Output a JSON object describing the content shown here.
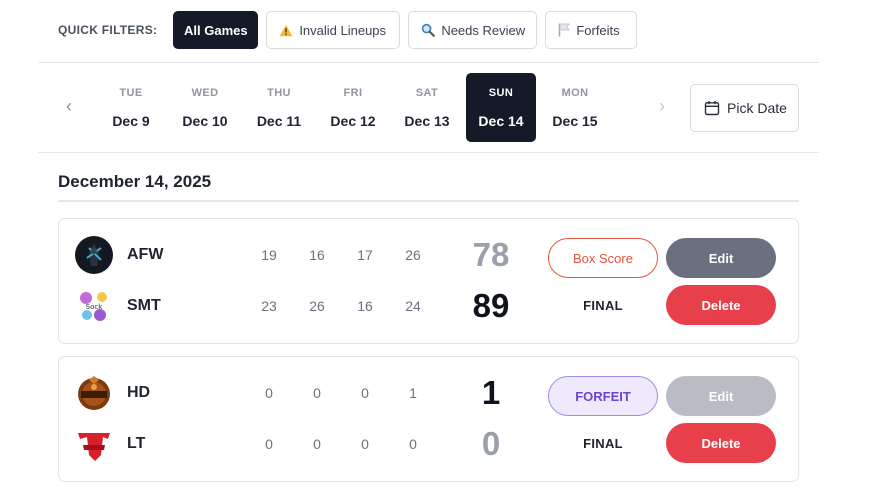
{
  "filters": {
    "label": "QUICK FILTERS:",
    "items": [
      {
        "label": "All Games",
        "icon": "none",
        "active": true
      },
      {
        "label": "Invalid Lineups",
        "icon": "warning-icon"
      },
      {
        "label": "Needs Review",
        "icon": "magnifier-icon"
      },
      {
        "label": "Forfeits",
        "icon": "flag-icon"
      }
    ]
  },
  "dates": {
    "prev_label": "‹",
    "next_label": "›",
    "days": [
      {
        "dow": "TUE",
        "date": "Dec 9"
      },
      {
        "dow": "WED",
        "date": "Dec 10"
      },
      {
        "dow": "THU",
        "date": "Dec 11"
      },
      {
        "dow": "FRI",
        "date": "Dec 12"
      },
      {
        "dow": "SAT",
        "date": "Dec 13"
      },
      {
        "dow": "SUN",
        "date": "Dec 14",
        "active": true
      },
      {
        "dow": "MON",
        "date": "Dec 15"
      }
    ],
    "pick_label": "Pick Date"
  },
  "heading": "December 14, 2025",
  "games": [
    {
      "home": {
        "name": "AFW",
        "quarters": [
          "19",
          "16",
          "17",
          "26"
        ],
        "total": "78",
        "result": "lose",
        "logo": "afw-logo"
      },
      "away": {
        "name": "SMT",
        "quarters": [
          "23",
          "26",
          "16",
          "24"
        ],
        "total": "89",
        "result": "win",
        "logo": "smt-logo"
      },
      "tag_label": "Box Score",
      "status": "FINAL",
      "edit_label": "Edit",
      "delete_label": "Delete"
    },
    {
      "home": {
        "name": "HD",
        "quarters": [
          "0",
          "0",
          "0",
          "1"
        ],
        "total": "1",
        "result": "win",
        "logo": "hd-logo"
      },
      "away": {
        "name": "LT",
        "quarters": [
          "0",
          "0",
          "0",
          "0"
        ],
        "total": "0",
        "result": "lose",
        "logo": "lt-logo"
      },
      "tag_label": "FORFEIT",
      "status": "FINAL",
      "edit_label": "Edit",
      "delete_label": "Delete"
    }
  ],
  "colors": {
    "active_bg": "#141a27",
    "box_score": "#e0563f",
    "forfeit": "#6d45cf",
    "delete": "#e8404a",
    "edit": "#6b7080"
  }
}
